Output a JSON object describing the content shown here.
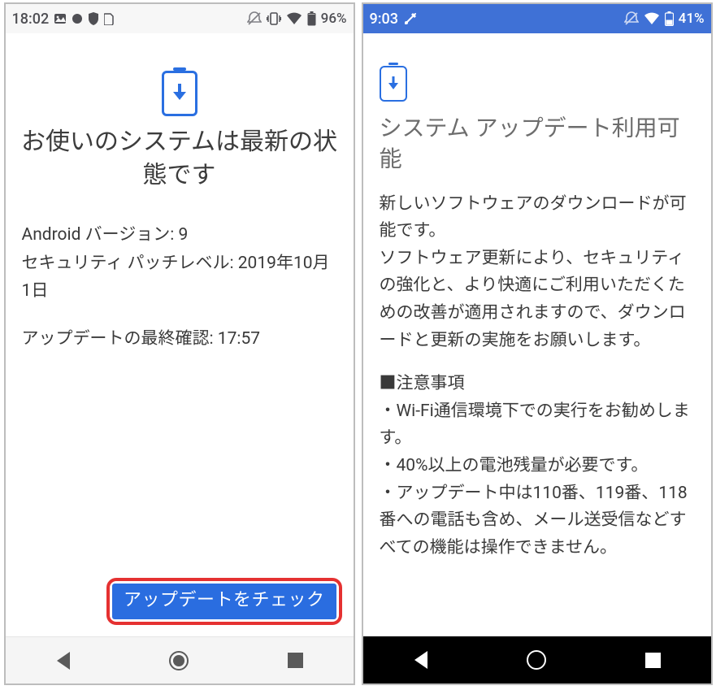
{
  "left": {
    "status": {
      "time": "18:02",
      "battery": "96%"
    },
    "title": "お使いのシステムは最新の状態です",
    "android_line": "Android バージョン: 9",
    "security_line": "セキュリティ パッチレベル: 2019年10月1日",
    "last_check_line": "アップデートの最終確認: 17:57",
    "cta": "アップデートをチェック"
  },
  "right": {
    "status": {
      "time": "9:03",
      "battery": "41%"
    },
    "title": "システム アップデート利用可能",
    "para1": "新しいソフトウェアのダウンロードが可能です。\nソフトウェア更新により、セキュリティの強化と、より快適にご利用いただくための改善が適用されますので、ダウンロードと更新の実施をお願いします。",
    "notes_heading": "■注意事項",
    "notes": [
      "・Wi-Fi通信環境下での実行をお勧めします。",
      "・40%以上の電池残量が必要です。",
      "・アップデート中は110番、119番、118番への電話も含め、メール送受信などすべての機能は操作できません。"
    ]
  }
}
